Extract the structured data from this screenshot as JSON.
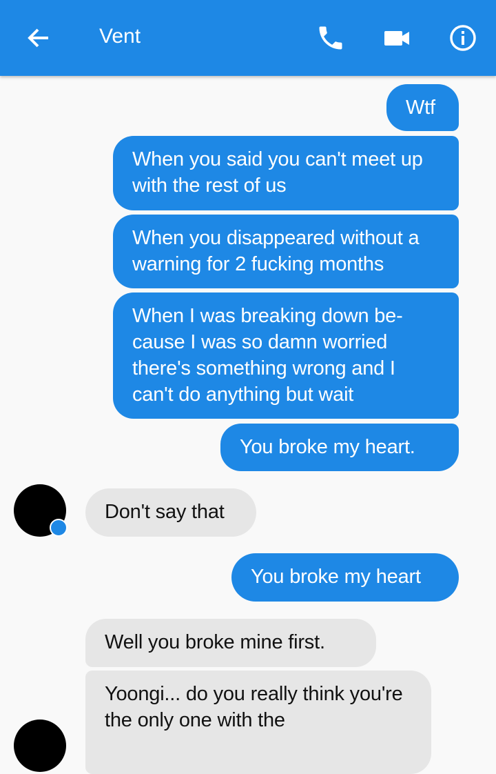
{
  "header": {
    "title": "Vent",
    "back_icon": "arrow-left-icon",
    "call_icon": "phone-icon",
    "video_icon": "video-camera-icon",
    "info_icon": "info-icon"
  },
  "colors": {
    "accent": "#1e88e5",
    "received_bubble": "#e6e6e6",
    "background": "#f9f9f9"
  },
  "messages": [
    {
      "from": "me",
      "text": "Wtf"
    },
    {
      "from": "me",
      "text": "When you said you can't meet up with the rest of us"
    },
    {
      "from": "me",
      "text": "When you disappeared without a warning for 2 fucking months"
    },
    {
      "from": "me",
      "text": "When I was breaking down be-cause I was so damn worried there's something wrong and I can't do anything but wait"
    },
    {
      "from": "me",
      "text": "You broke my heart."
    },
    {
      "from": "them",
      "text": "Don't say that"
    },
    {
      "from": "me",
      "text": "You broke my heart"
    },
    {
      "from": "them",
      "text": "Well you broke mine first."
    },
    {
      "from": "them",
      "text": "Yoongi... do you really think you're the only one with the"
    }
  ]
}
